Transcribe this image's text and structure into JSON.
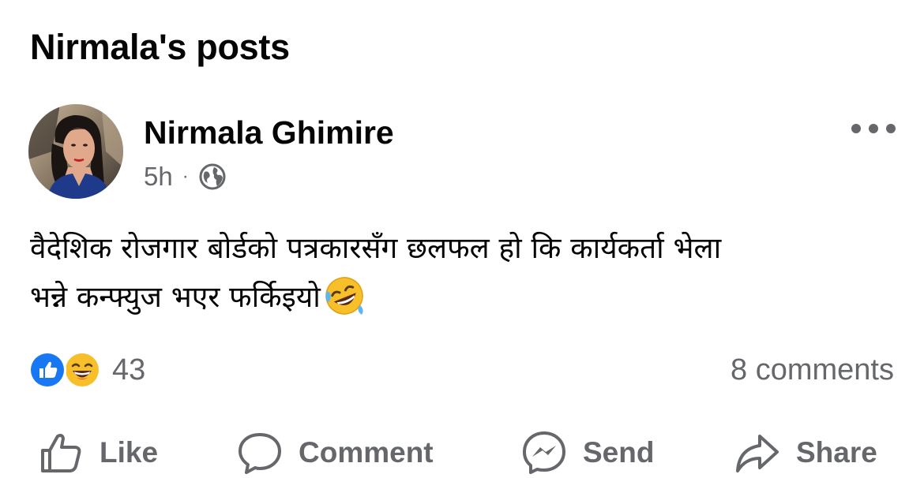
{
  "page": {
    "title": "Nirmala's posts"
  },
  "post": {
    "author": "Nirmala Ghimire",
    "time": "5h",
    "separator": "·",
    "privacy_icon": "globe-icon",
    "text_line1": "वैदेशिक रोजगार बोर्डको पत्रकारसँग छलफल हो कि कार्यकर्ता भेला",
    "text_line2": "भन्ने कन्फ्युज भएर फर्किइयो",
    "trailing_emoji": "rolling-on-floor-laughing-emoji"
  },
  "reactions": {
    "types": [
      "like",
      "haha"
    ],
    "count": "43",
    "comments": "8 comments"
  },
  "actions": {
    "like": "Like",
    "comment": "Comment",
    "send": "Send",
    "share": "Share"
  },
  "colors": {
    "text": "#050505",
    "secondary": "#65676b",
    "like_blue": "#1877f2",
    "haha_yellow": "#f7c02b"
  }
}
